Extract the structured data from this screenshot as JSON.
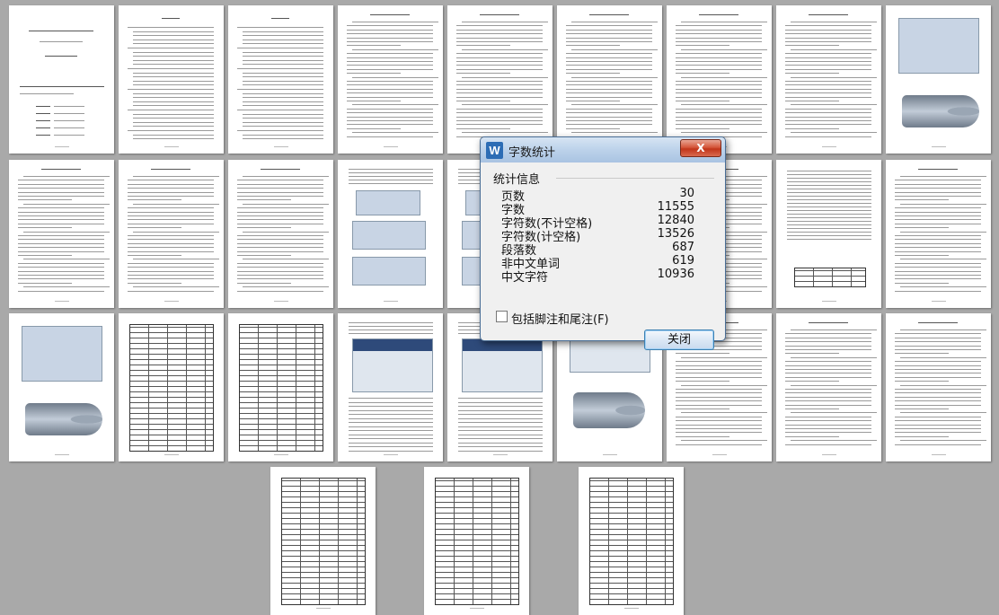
{
  "dialog": {
    "title": "字数统计",
    "app_icon_letter": "W",
    "close_label": "X",
    "group_label": "统计信息",
    "stats": [
      {
        "label": "页数",
        "value": "30"
      },
      {
        "label": "字数",
        "value": "11555"
      },
      {
        "label": "字符数(不计空格)",
        "value": "12840"
      },
      {
        "label": "字符数(计空格)",
        "value": "13526"
      },
      {
        "label": "段落数",
        "value": "687"
      },
      {
        "label": "非中文单词",
        "value": "619"
      },
      {
        "label": "中文字符",
        "value": "10936"
      }
    ],
    "checkbox_label": "包括脚注和尾注(F)",
    "checkbox_checked": false,
    "button_label": "关闭"
  }
}
